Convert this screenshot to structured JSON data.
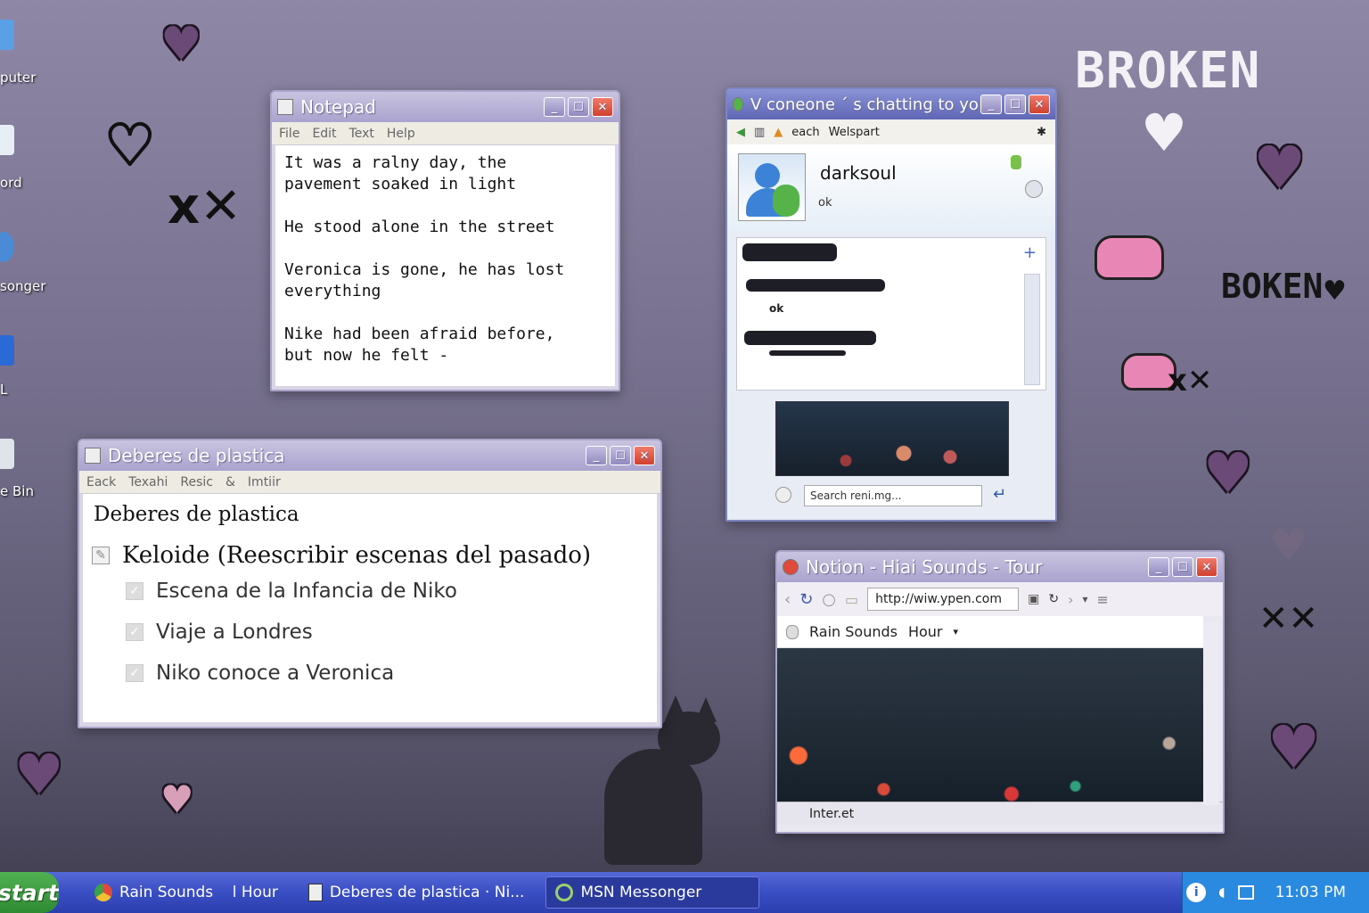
{
  "desktop": {
    "icons": [
      {
        "label": "puter",
        "icon": "computer-icon"
      },
      {
        "label": "ord",
        "icon": "document-icon"
      },
      {
        "label": "songer",
        "icon": "messenger-icon"
      },
      {
        "label": "L",
        "icon": "app-icon"
      },
      {
        "label": "e Bin",
        "icon": "recycle-bin-icon"
      }
    ],
    "decor": {
      "broken": "BROKEN",
      "boken": "BOKEN"
    }
  },
  "notepad": {
    "title": "Notepad",
    "menu": [
      "File",
      "Edit",
      "Text",
      "Help"
    ],
    "content": "It was a ralny day, the\npavement soaked in light\n\nHe stood alone in the street\n\nVeronica is gone, he has lost\neverything\n\nNike had been afraid before,\nbut now he felt -"
  },
  "deberes": {
    "title": "Deberes de plastica",
    "menu": [
      "Eack",
      "Texahi",
      "Resic",
      "&",
      "Imtiir"
    ],
    "doc_title": "Deberes de plastica",
    "main_task": "Keloide (Reescribir escenas del pasado)",
    "subtasks": [
      "Escena de la Infancia de Niko",
      "Viaje a Londres",
      "Niko conoce a Veronica"
    ]
  },
  "msn": {
    "title": "V coneone ´ s chatting to you",
    "toolbar": [
      "each",
      "Welspart"
    ],
    "contact_name": "darksoul",
    "status": "ok",
    "messages": [
      "ok"
    ],
    "search_placeholder": "Search reni.mg..."
  },
  "browser": {
    "title": "Notion - Hiai Sounds - Tour",
    "url": "http://wiw.ypen.com",
    "tab_label": "Rain Sounds",
    "tab_extra": "Hour",
    "status": "Inter.et"
  },
  "taskbar": {
    "start": "start",
    "items": [
      {
        "label": "Rain Sounds    l Hour",
        "icon": "chrome-icon"
      },
      {
        "label": "Deberes de plastica · Ni...",
        "icon": "notepad-icon"
      },
      {
        "label": "MSN Messonger",
        "icon": "msn-icon"
      }
    ],
    "clock": "11:03 PM"
  },
  "colors": {
    "accent": "#3a4ec4",
    "titlebar": "#a9a3cf",
    "msn_titlebar": "#5f67b6",
    "start": "#2f8a32"
  }
}
